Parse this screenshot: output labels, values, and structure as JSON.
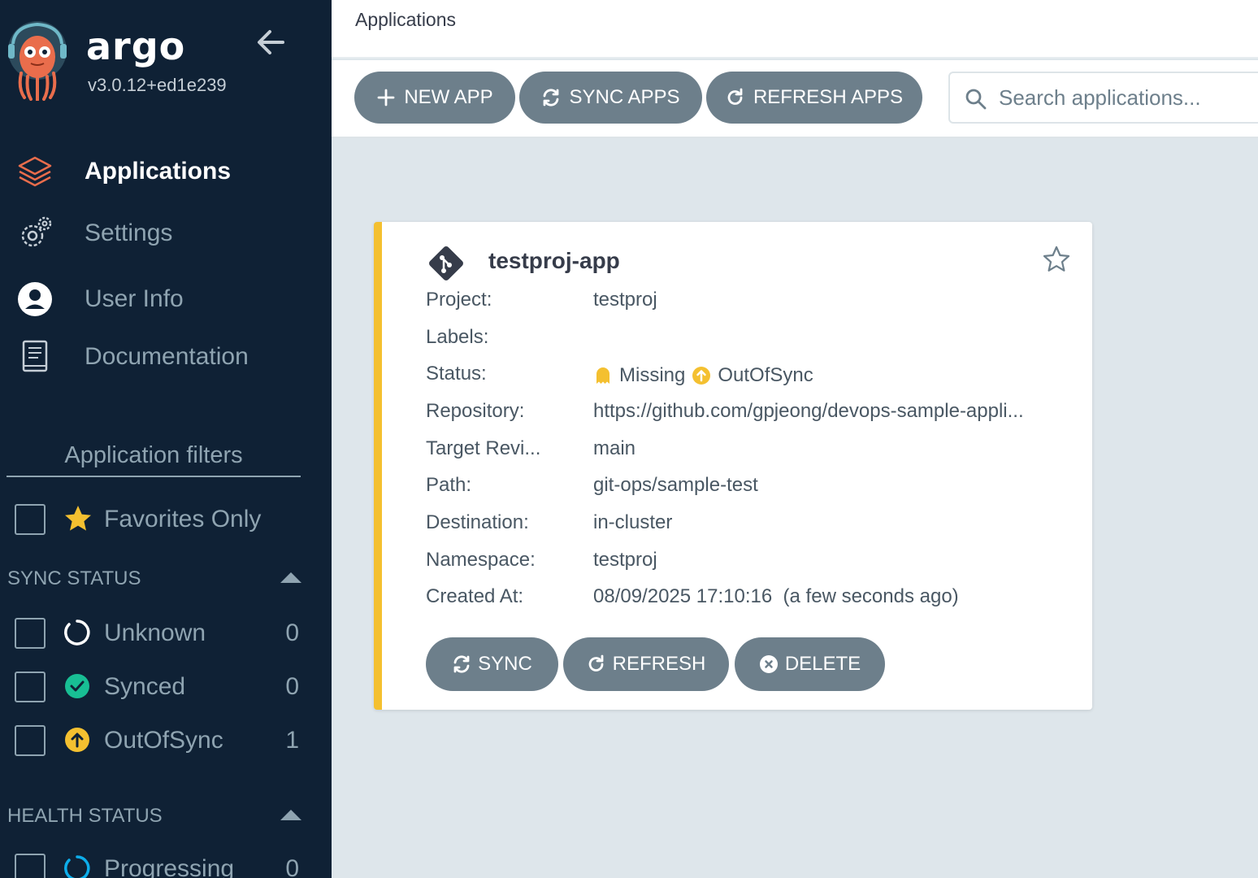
{
  "sidebar": {
    "brand": "argo",
    "version": "v3.0.12+ed1e239",
    "nav": [
      {
        "label": "Applications",
        "icon": "layers-icon",
        "active": true
      },
      {
        "label": "Settings",
        "icon": "gears-icon"
      },
      {
        "label": "User Info",
        "icon": "user-circle-icon"
      },
      {
        "label": "Documentation",
        "icon": "book-icon"
      }
    ],
    "filters_title": "Application filters",
    "favorites_label": "Favorites Only",
    "sync_status": {
      "heading": "SYNC STATUS",
      "items": [
        {
          "label": "Unknown",
          "count": "0"
        },
        {
          "label": "Synced",
          "count": "0"
        },
        {
          "label": "OutOfSync",
          "count": "1"
        }
      ]
    },
    "health_status": {
      "heading": "HEALTH STATUS",
      "items": [
        {
          "label": "Progressing",
          "count": "0"
        }
      ]
    }
  },
  "header": {
    "title": "Applications"
  },
  "toolbar": {
    "new_app": "NEW APP",
    "sync_apps": "SYNC APPS",
    "refresh_apps": "REFRESH APPS",
    "search_placeholder": "Search applications..."
  },
  "app_card": {
    "name": "testproj-app",
    "fields": {
      "project": {
        "label": "Project:",
        "value": "testproj"
      },
      "labels": {
        "label": "Labels:",
        "value": ""
      },
      "status": {
        "label": "Status:",
        "health": "Missing",
        "sync": "OutOfSync"
      },
      "repository": {
        "label": "Repository:",
        "value": "https://github.com/gpjeong/devops-sample-appli..."
      },
      "target_revision": {
        "label": "Target Revi...",
        "value": "main"
      },
      "path": {
        "label": "Path:",
        "value": "git-ops/sample-test"
      },
      "destination": {
        "label": "Destination:",
        "value": "in-cluster"
      },
      "namespace": {
        "label": "Namespace:",
        "value": "testproj"
      },
      "created_at": {
        "label": "Created At:",
        "value": "08/09/2025 17:10:16  (a few seconds ago)"
      }
    },
    "buttons": {
      "sync": "SYNC",
      "refresh": "REFRESH",
      "delete": "DELETE"
    }
  },
  "colors": {
    "sidebar_bg": "#0f2135",
    "accent_orange": "#e96d4c",
    "out_of_sync": "#f4c030",
    "synced": "#18be94",
    "button_gray": "#6d7f8b",
    "progressing": "#0dadea"
  }
}
